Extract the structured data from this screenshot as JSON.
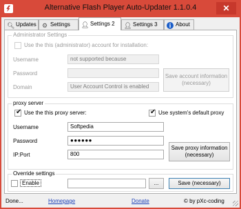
{
  "window": {
    "title": "Alternative Flash Player Auto-Updater 1.1.0.4",
    "close_label": "✕"
  },
  "tabs": [
    {
      "label": "Updates",
      "icon": "search-icon"
    },
    {
      "label": "Settings",
      "icon": "gear-icon"
    },
    {
      "label": "Settings 2",
      "icon": "user-icon",
      "active": true
    },
    {
      "label": "Settings 3",
      "icon": "user-icon"
    },
    {
      "label": "About",
      "icon": "info-icon"
    }
  ],
  "admin": {
    "legend": "Administrator Settings",
    "use_account_label": "Use the this (administrator) account for installation:",
    "use_account_checked": false,
    "username_label": "Username",
    "username_value": "not supported because",
    "password_label": "Password",
    "password_value": "",
    "domain_label": "Domain",
    "domain_value": "User Account Control is enabled",
    "save_button": "Save account information (necessary)"
  },
  "proxy": {
    "legend": "proxy server",
    "use_proxy_label": "Use the this proxy server:",
    "use_proxy_checked": true,
    "default_proxy_label": "Use system's default proxy",
    "default_proxy_checked": true,
    "username_label": "Username",
    "username_value": "Softpedia",
    "password_label": "Password",
    "password_value": "●●●●●●",
    "ipport_label": "IP:Port",
    "ipport_value": "800",
    "save_button": "Save proxy information (necessary)"
  },
  "override": {
    "legend": "Override settings",
    "enable_label": "Enable",
    "enable_checked": false,
    "path_value": "",
    "browse_label": "...",
    "save_button": "Save (necessary)"
  },
  "status": {
    "text": "Done...",
    "homepage": "Homepage",
    "donate": "Donate",
    "copyright": "© by pXc-coding"
  }
}
